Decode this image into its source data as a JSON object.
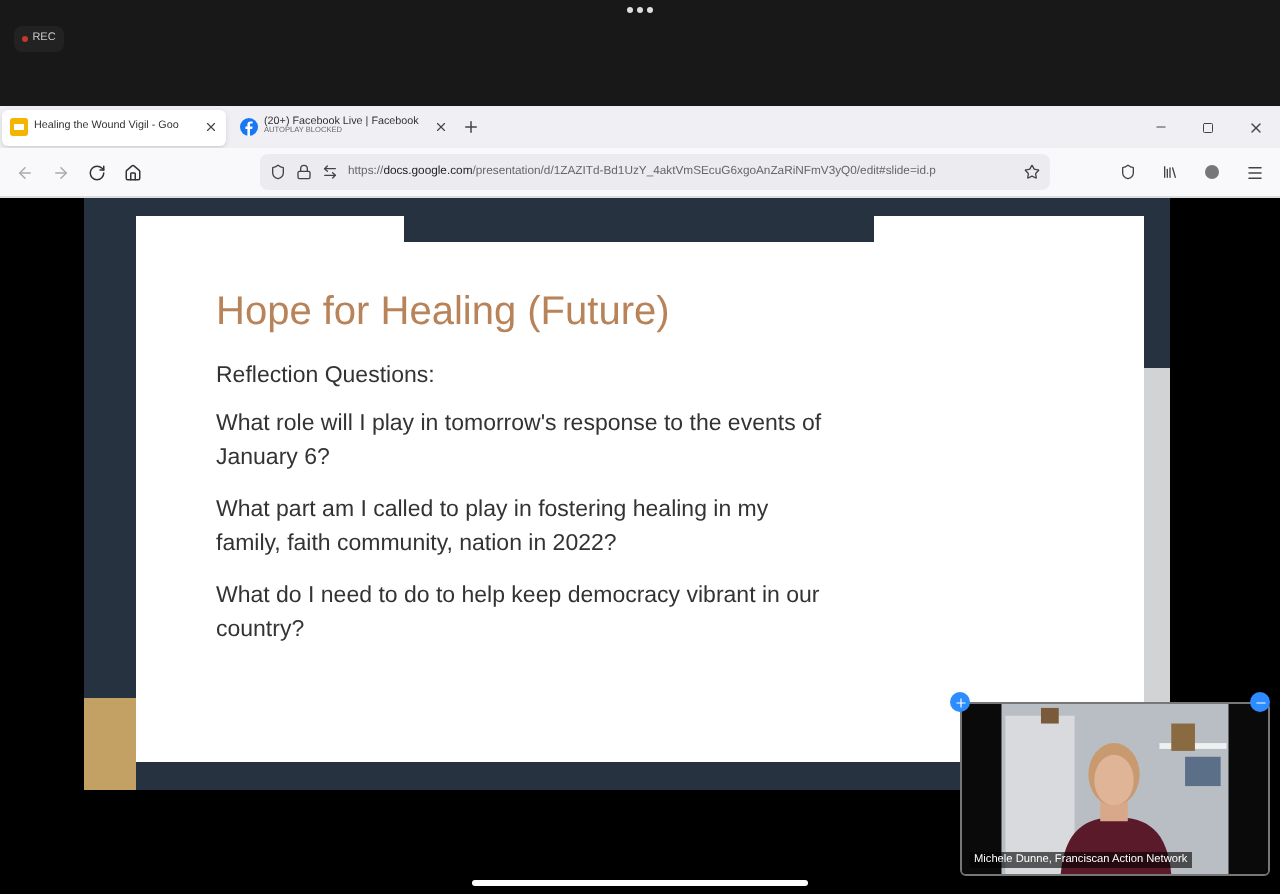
{
  "meeting": {
    "recording_label": "REC"
  },
  "browser": {
    "tabs": [
      {
        "title": "Healing the Wound Vigil - Goo",
        "selected": true,
        "kind": "slides"
      },
      {
        "title": "(20+) Facebook Live | Facebook",
        "subtitle": "AUTOPLAY BLOCKED",
        "selected": false,
        "kind": "facebook"
      }
    ],
    "url": "https://**docs.google.com**/presentation/d/1ZAZITd-Bd1UzY_4aktVmSEcuG6xgoAnZaRiNFmV3yQ0/edit#slide=id.p"
  },
  "slide": {
    "title": "Hope for Healing (Future)",
    "heading": "Reflection Questions:",
    "questions": [
      "What role will I play in tomorrow's response to the events of January 6?",
      "What part am I called to play in fostering healing in my family, faith community, nation in 2022?",
      "What do I need to do to help keep democracy vibrant in our country?"
    ]
  },
  "video": {
    "name": "Michele Dunne, Franciscan Action Network"
  }
}
